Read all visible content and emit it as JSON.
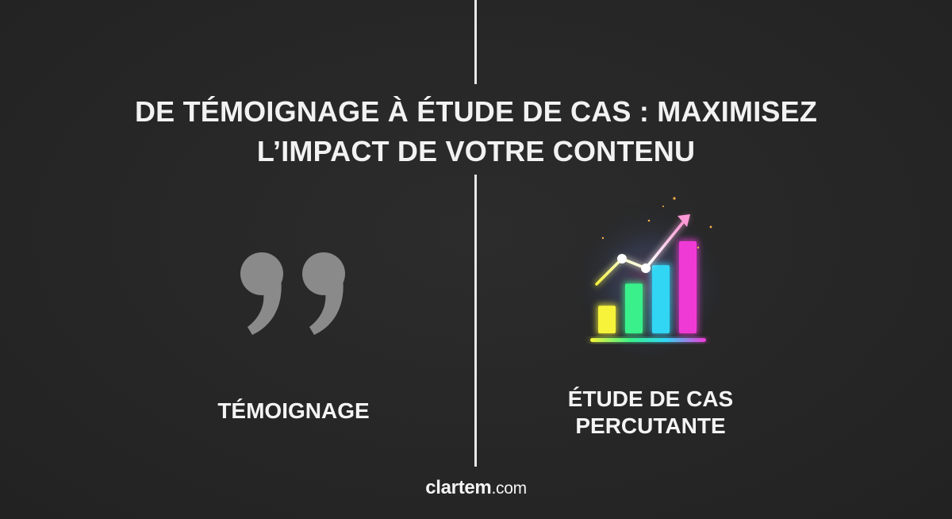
{
  "title": {
    "line1": "DE TÉMOIGNAGE À ÉTUDE DE CAS : MAXIMISEZ",
    "line2": "L’IMPACT DE VOTRE CONTENU"
  },
  "left_panel": {
    "icon": "quote-mark-icon",
    "label": "TÉMOIGNAGE"
  },
  "right_panel": {
    "icon": "rising-bar-chart-icon",
    "label_line1": "ÉTUDE DE CAS",
    "label_line2": "PERCUTANTE",
    "bar_levels": [
      0.3,
      0.54,
      0.74,
      1.0
    ],
    "bar_colors": [
      "#f6f33a",
      "#39f08a",
      "#32d6f5",
      "#f03ad6"
    ]
  },
  "brand": {
    "name": "clartem",
    "tld": ".com"
  },
  "colors": {
    "background": "#282828",
    "text": "#f2f2f2",
    "quote": "#8a8a8a",
    "divider": "#e9e9e9"
  }
}
